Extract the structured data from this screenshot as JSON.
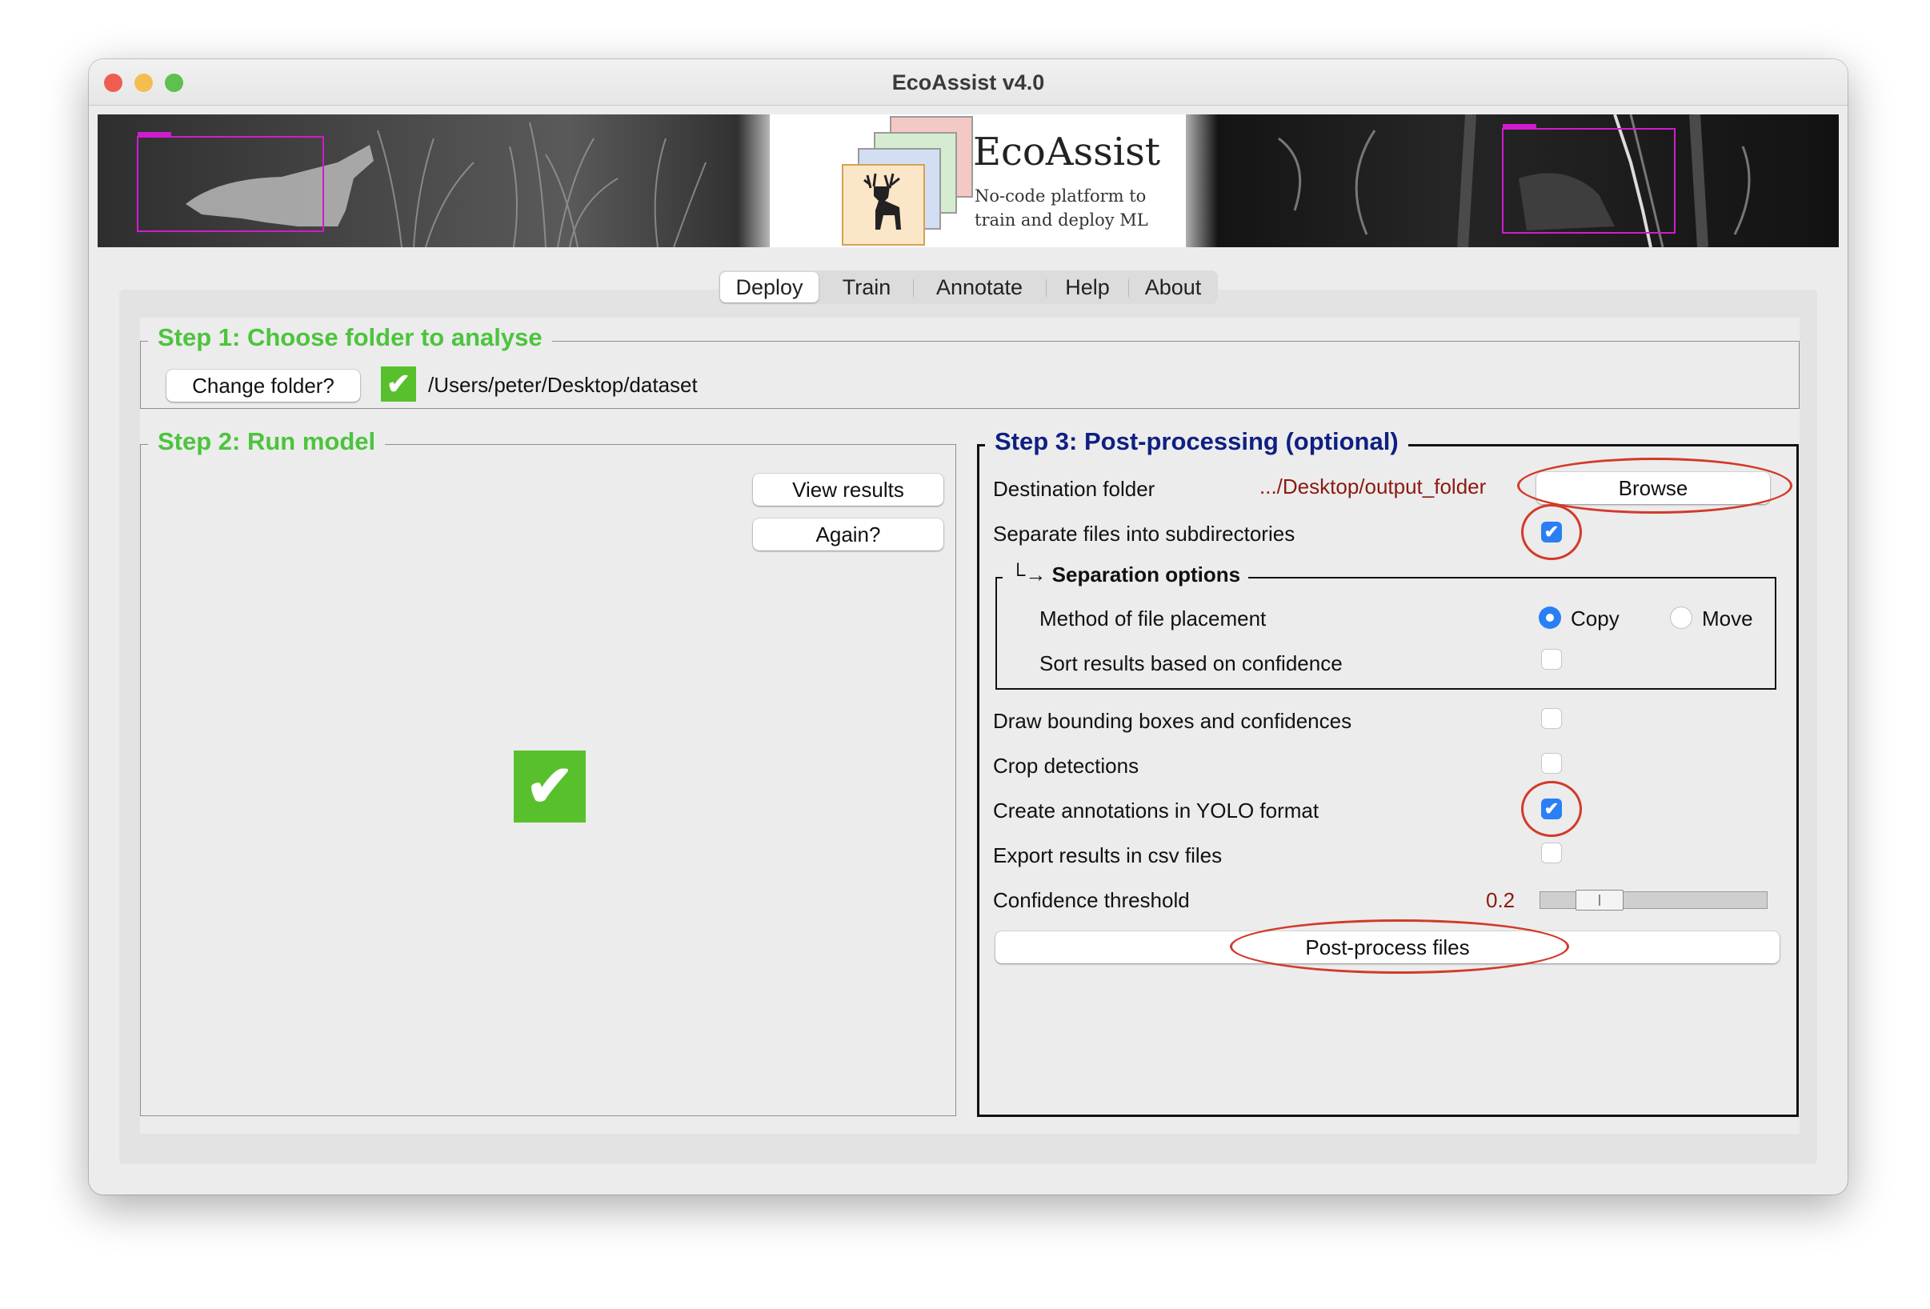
{
  "window": {
    "title": "EcoAssist v4.0"
  },
  "banner": {
    "brand_title": "EcoAssist",
    "brand_subtitle_line1": "No-code platform to",
    "brand_subtitle_line2": "train and deploy ML"
  },
  "tabs": [
    {
      "label": "Deploy",
      "selected": true
    },
    {
      "label": "Train",
      "selected": false
    },
    {
      "label": "Annotate",
      "selected": false
    },
    {
      "label": "Help",
      "selected": false
    },
    {
      "label": "About",
      "selected": false
    }
  ],
  "step1": {
    "title": "Step 1: Choose folder to analyse",
    "change_folder_label": "Change folder?",
    "folder_path": "/Users/peter/Desktop/dataset"
  },
  "step2": {
    "title": "Step 2: Run model",
    "view_results_label": "View results",
    "again_label": "Again?"
  },
  "step3": {
    "title": "Step 3: Post-processing (optional)",
    "destination_label": "Destination folder",
    "destination_value": ".../Desktop/output_folder",
    "browse_label": "Browse",
    "separate_label": "Separate files into subdirectories",
    "separate_checked": true,
    "separation": {
      "title": "Separation options",
      "method_label": "Method of file placement",
      "copy_label": "Copy",
      "move_label": "Move",
      "selected_method": "Copy",
      "sort_label": "Sort results based on confidence",
      "sort_checked": false
    },
    "draw_label": "Draw bounding boxes and confidences",
    "draw_checked": false,
    "crop_label": "Crop detections",
    "crop_checked": false,
    "yolo_label": "Create annotations in YOLO format",
    "yolo_checked": true,
    "csv_label": "Export results in csv files",
    "csv_checked": false,
    "confidence_label": "Confidence threshold",
    "confidence_value": "0.2",
    "postprocess_label": "Post-process files"
  },
  "colors": {
    "step_green": "#4cc43c",
    "step3_navy": "#0f1f82",
    "path_red": "#8b1a10",
    "annotation_red": "#d23a2a",
    "checkbox_blue": "#2a7ff4"
  },
  "icons": {
    "checkmark": "✔",
    "corner_arrow": "└→"
  }
}
